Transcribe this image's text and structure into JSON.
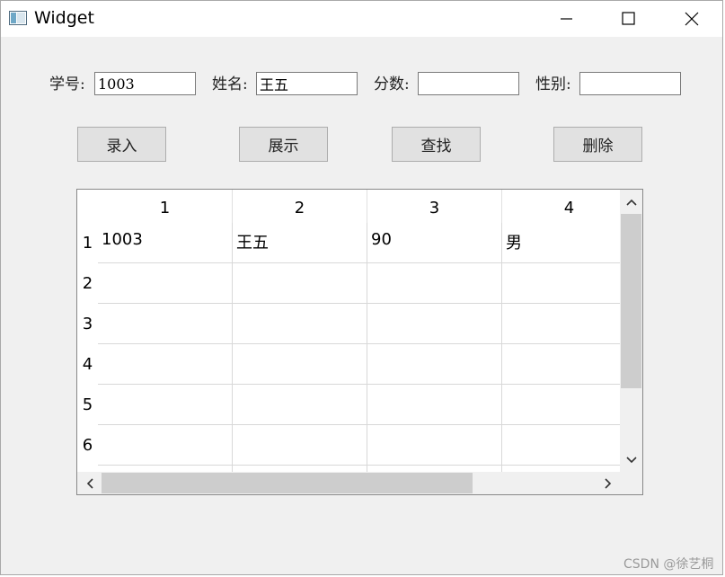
{
  "window": {
    "title": "Widget"
  },
  "form": {
    "fields": [
      {
        "label": "学号:",
        "value": "1003"
      },
      {
        "label": "姓名:",
        "value": "王五"
      },
      {
        "label": "分数:",
        "value": ""
      },
      {
        "label": "性别:",
        "value": ""
      }
    ]
  },
  "buttons": {
    "enter": "录入",
    "show": "展示",
    "find": "查找",
    "delete": "删除"
  },
  "table": {
    "columns": [
      "1",
      "2",
      "3",
      "4"
    ],
    "rows": [
      "1",
      "2",
      "3",
      "4",
      "5",
      "6"
    ],
    "cells": [
      [
        "1003",
        "王五",
        "90",
        "男"
      ],
      [
        "",
        "",
        "",
        ""
      ],
      [
        "",
        "",
        "",
        ""
      ],
      [
        "",
        "",
        "",
        ""
      ],
      [
        "",
        "",
        "",
        ""
      ],
      [
        "",
        "",
        "",
        ""
      ]
    ]
  },
  "watermark": "CSDN @徐艺桐"
}
